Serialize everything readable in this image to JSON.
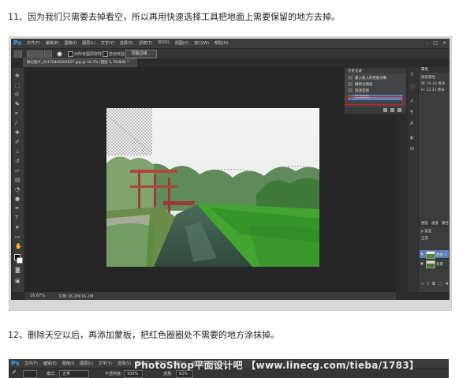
{
  "captions": {
    "step11": "11、因为我们只需要去掉看空，所以再用快速选择工具把地面上需要保留的地方去掉。",
    "step12": "12、删除天空以后，再添加蒙板，把红色圈圈处不需要的地方涂抹掉。"
  },
  "ps1": {
    "logo": "Ps",
    "menus": [
      "文件(F)",
      "编辑(E)",
      "图像(I)",
      "图层(L)",
      "文字(Y)",
      "选择(S)",
      "滤镜(T)",
      "3D(D)",
      "视图(V)",
      "窗口(W)",
      "帮助(H)"
    ],
    "options": {
      "sample_all_layers": "对所有图层取样",
      "auto_enhance": "自动增强",
      "refine_edge": "调整边缘..."
    },
    "doc_tab": "微信图片_20170404202657.jpg @ 16.7% (图层 1, RGB/8) *",
    "history_panel": {
      "title": "历史记录",
      "items": [
        "置入嵌入的智能对象",
        "栅格化图层",
        "快速选择",
        "快速选择"
      ],
      "selected_index": 3
    },
    "right_panel": {
      "tab_properties": "属性",
      "prop_label": "图层属性",
      "prop_w": "W: 16.43 厘米",
      "prop_h": "H: 12.33 厘米",
      "tab_layers": "图层",
      "tab_channels": "通道",
      "tab_paths": "路径",
      "filter_kind": "ρ 类型",
      "blend_mode": "正常",
      "layers": [
        "图层 1",
        "背景"
      ],
      "selected_layer": 0
    },
    "status": {
      "zoom": "16.67%",
      "doc_size": "文档:16.2M/16.2M"
    }
  },
  "ps2": {
    "logo": "Ps",
    "menus": [
      "文件(F)",
      "编辑(E)",
      "图像(I)",
      "图层(L)",
      "文字(Y)",
      "选择(S)",
      "滤镜(T)",
      "3D(D)",
      "视图(V)",
      "窗口(W)",
      "帮助(H)"
    ],
    "options": {
      "mode_label": "模式:",
      "mode_value": "正常",
      "opacity_label": "不透明度:",
      "opacity_value": "100%",
      "flow_label": "流量:",
      "flow_value": "62%"
    }
  },
  "watermark": "PhotoShop平面设计吧 【www.linecg.com/tieba/1783】"
}
